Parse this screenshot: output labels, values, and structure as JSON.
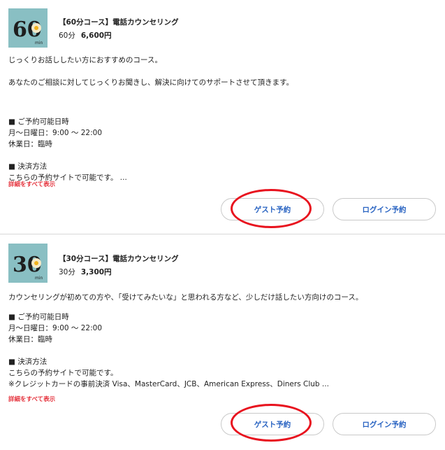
{
  "courses": [
    {
      "title": "【60分コース】電話カウンセリング",
      "duration": "60分",
      "price": "6,600円",
      "thumb_number": "60",
      "thumb_unit": "min",
      "description": [
        "じっくりお話ししたい方におすすめのコース。",
        "",
        "あなたのご相談に対してじっくりお聞きし、解決に向けてのサポートさせて頂きます。",
        "",
        "",
        "■ ご予約可能日時",
        "月〜日曜日：9:00 〜 22:00",
        "休業日：臨時",
        "",
        "■ 決済方法",
        "こちらの予約サイトで可能です。 ..."
      ],
      "more_label": "詳細をすべて表示",
      "guest_label": "ゲスト予約",
      "login_label": "ログイン予約"
    },
    {
      "title": "【30分コース】電話カウンセリング",
      "duration": "30分",
      "price": "3,300円",
      "thumb_number": "30",
      "thumb_unit": "min",
      "description": [
        "カウンセリングが初めての方や、「受けてみたいな」と思われる方など、少しだけ話したい方向けのコース。",
        "",
        "■ ご予約可能日時",
        "月〜日曜日：9:00 〜 22:00",
        "休業日：臨時",
        "",
        "■ 決済方法",
        "こちらの予約サイトで可能です。",
        "※クレジットカードの事前決済 Visa、MasterCard、JCB、American Express、Diners Club ..."
      ],
      "more_label": "詳細をすべて表示",
      "guest_label": "ゲスト予約",
      "login_label": "ログイン予約"
    }
  ],
  "colors": {
    "link": "#2a64c2",
    "more": "#e5343e",
    "annotation_ring": "#e8121e",
    "thumb_bg": "#89bfc3"
  }
}
